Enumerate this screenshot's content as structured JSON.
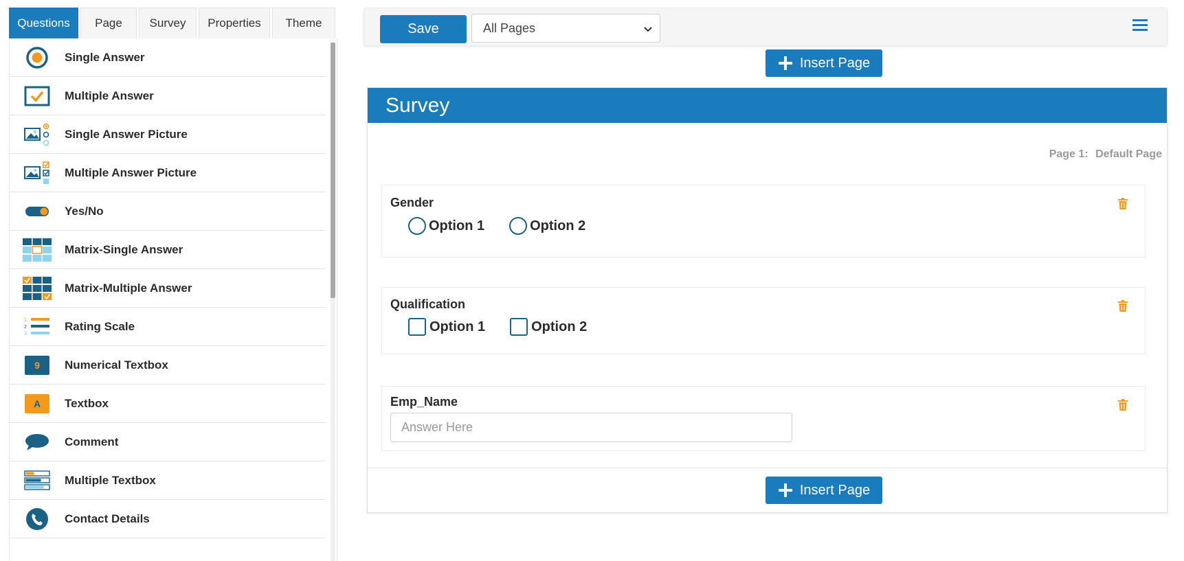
{
  "tabs": [
    {
      "label": "Questions",
      "active": true
    },
    {
      "label": "Page"
    },
    {
      "label": "Survey"
    },
    {
      "label": "Properties"
    },
    {
      "label": "Theme"
    }
  ],
  "tools": [
    {
      "label": "Single Answer",
      "icon": "single-answer-icon"
    },
    {
      "label": "Multiple Answer",
      "icon": "multiple-answer-icon"
    },
    {
      "label": "Single Answer Picture",
      "icon": "single-answer-picture-icon"
    },
    {
      "label": "Multiple Answer Picture",
      "icon": "multiple-answer-picture-icon"
    },
    {
      "label": "Yes/No",
      "icon": "yes-no-toggle-icon"
    },
    {
      "label": "Matrix-Single Answer",
      "icon": "matrix-single-icon"
    },
    {
      "label": "Matrix-Multiple Answer",
      "icon": "matrix-multiple-icon"
    },
    {
      "label": "Rating Scale",
      "icon": "rating-scale-icon"
    },
    {
      "label": "Numerical Textbox",
      "icon": "numerical-textbox-icon",
      "glyph": "9"
    },
    {
      "label": "Textbox",
      "icon": "textbox-icon",
      "glyph": "A"
    },
    {
      "label": "Comment",
      "icon": "comment-icon"
    },
    {
      "label": "Multiple Textbox",
      "icon": "multiple-textbox-icon"
    },
    {
      "label": "Contact Details",
      "icon": "phone-icon"
    }
  ],
  "toolbar": {
    "save_label": "Save",
    "page_filter": "All Pages"
  },
  "insert_label": "Insert Page",
  "survey": {
    "title": "Survey",
    "page_label": "Page 1:",
    "page_name": "Default Page",
    "questions": [
      {
        "title": "Gender",
        "type": "radio",
        "options": [
          "Option 1",
          "Option 2"
        ]
      },
      {
        "title": "Qualification",
        "type": "checkbox",
        "options": [
          "Option 1",
          "Option 2"
        ]
      },
      {
        "title": "Emp_Name",
        "type": "text",
        "placeholder": "Answer Here"
      }
    ]
  },
  "colors": {
    "primary": "#1a7bbd",
    "dark_teal": "#1b6186",
    "orange": "#f39a1e",
    "light_blue": "#8fd3ef"
  }
}
